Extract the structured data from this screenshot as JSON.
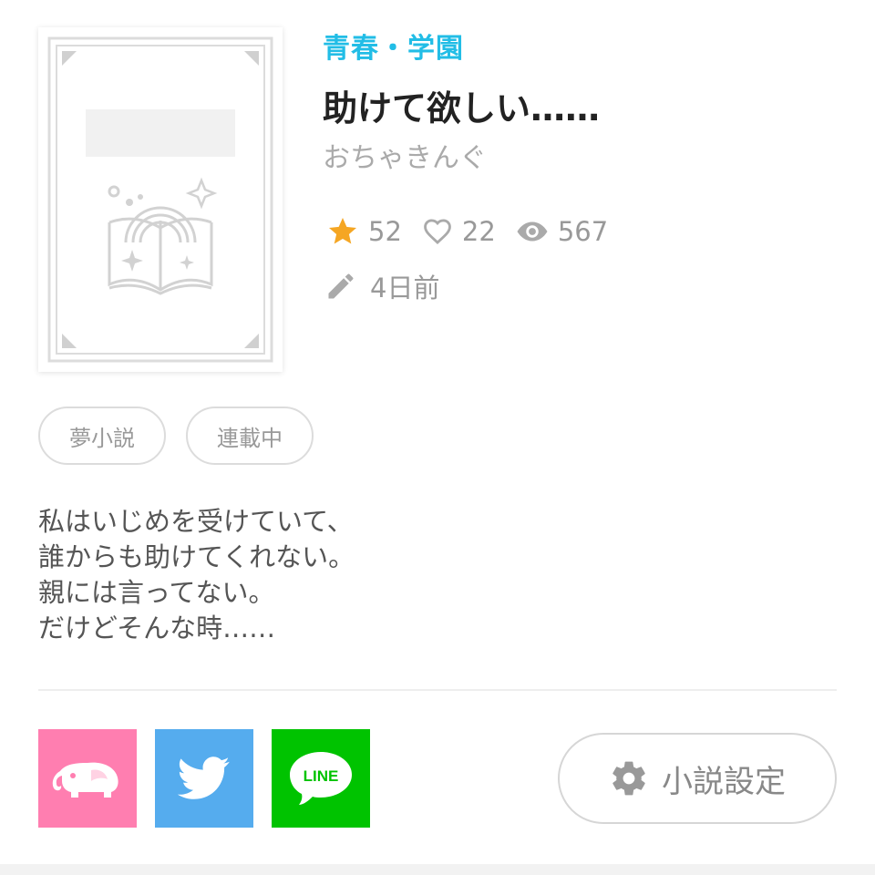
{
  "novel": {
    "genre": "青春・学園",
    "title": "助けて欲しい……",
    "author": "おちゃきんぐ",
    "stats": {
      "stars": "52",
      "likes": "22",
      "views": "567"
    },
    "updated": "4日前",
    "tags": [
      "夢小説",
      "連載中"
    ],
    "synopsis": [
      "私はいじめを受けていて、",
      "誰からも助けてくれない。",
      "親には言ってない。",
      "だけどそんな時……"
    ]
  },
  "share": {
    "line_label": "LINE"
  },
  "settings": {
    "label": "小説設定"
  },
  "colors": {
    "accent": "#22bde6",
    "star": "#f5a623",
    "elephant_bg": "#ff7eb0",
    "twitter_bg": "#55acee",
    "line_bg": "#00c300"
  }
}
